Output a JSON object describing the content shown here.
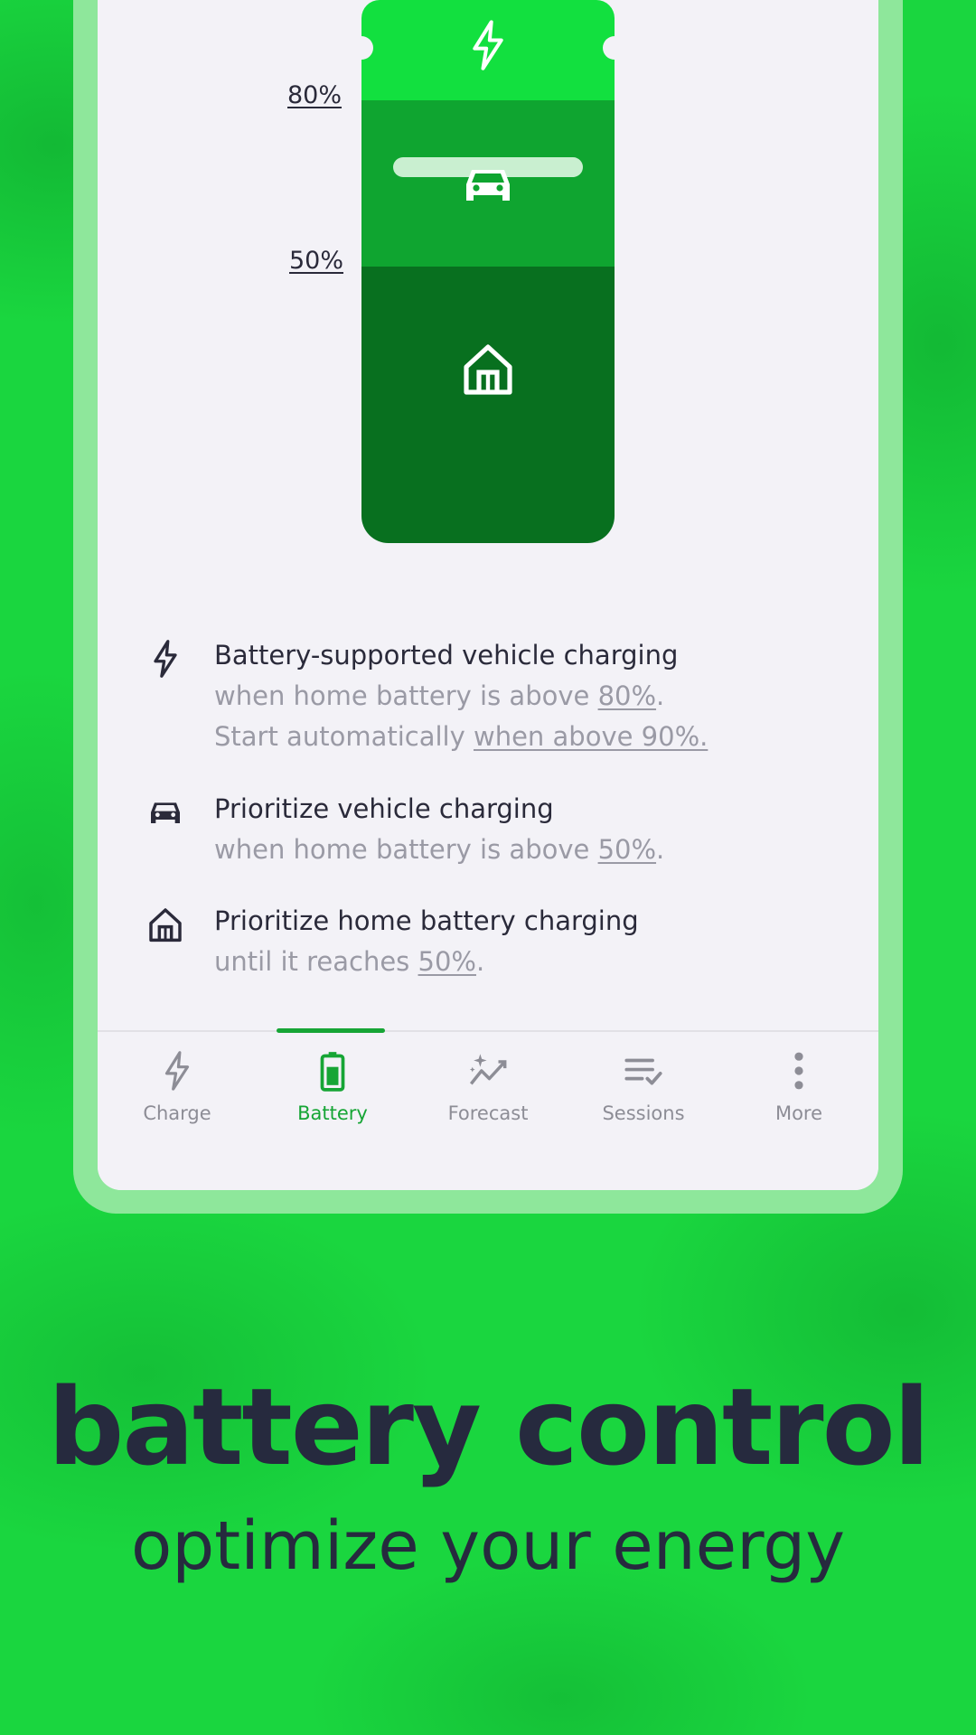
{
  "battery_levels": {
    "label_80": "80%",
    "label_50": "50%"
  },
  "legend": [
    {
      "icon": "bolt-icon",
      "title": "Battery-supported vehicle charging",
      "line1_prefix": "when home battery is above ",
      "line1_value": "80%",
      "line1_suffix": ".",
      "line2_prefix": "Start automatically ",
      "line2_value": "when above 90%."
    },
    {
      "icon": "car-icon",
      "title": "Prioritize vehicle charging",
      "line1_prefix": "when home battery is above ",
      "line1_value": "50%",
      "line1_suffix": "."
    },
    {
      "icon": "home-icon",
      "title": "Prioritize home battery charging",
      "line1_prefix": "until it reaches ",
      "line1_value": "50%",
      "line1_suffix": "."
    }
  ],
  "nav": {
    "active": "Battery",
    "items": [
      {
        "label": "Charge",
        "icon": "bolt-icon"
      },
      {
        "label": "Battery",
        "icon": "battery-icon"
      },
      {
        "label": "Forecast",
        "icon": "forecast-sparkle-icon"
      },
      {
        "label": "Sessions",
        "icon": "list-check-icon"
      },
      {
        "label": "More",
        "icon": "more-vertical-icon"
      }
    ]
  },
  "colors": {
    "background": "#1ad63f",
    "accent": "#16a535",
    "battery_top": "#12e03f",
    "battery_mid": "#0fa530",
    "battery_bottom": "#08701f",
    "text_dark": "#262a3e",
    "text_muted": "#9a9aa5"
  },
  "promo": {
    "headline": "battery control",
    "subline": "optimize your energy"
  }
}
